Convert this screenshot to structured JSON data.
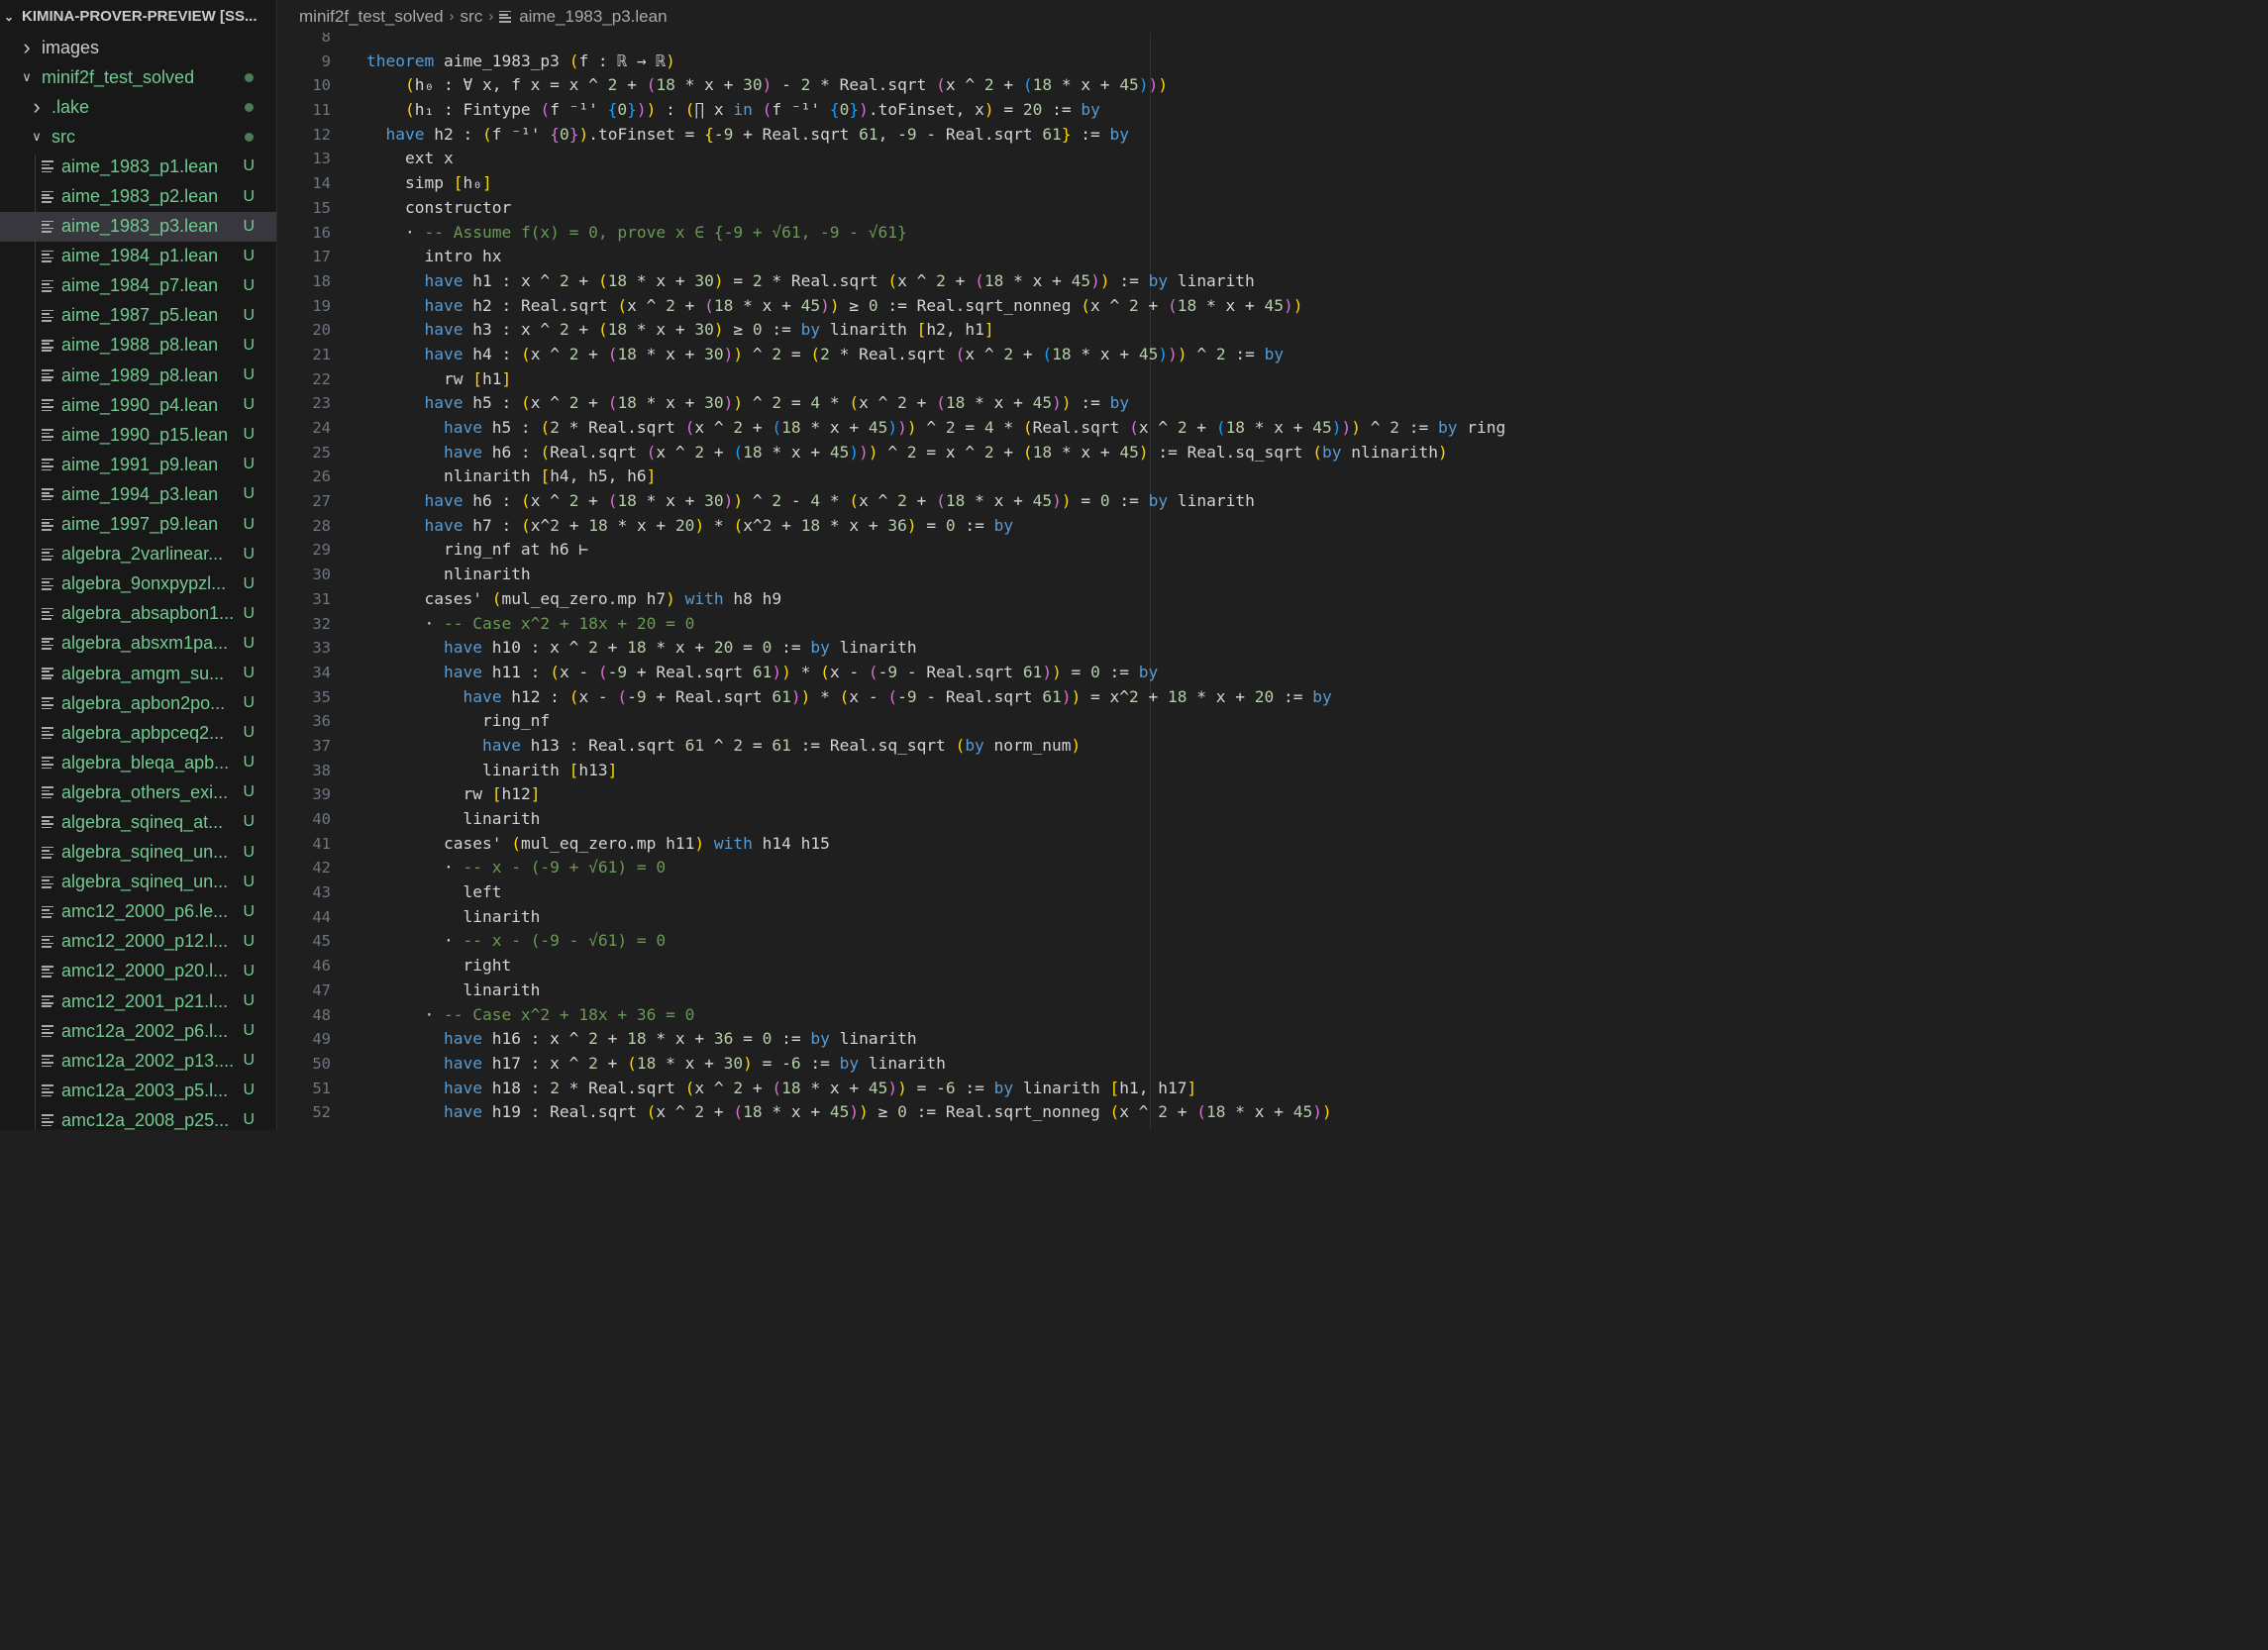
{
  "explorer": {
    "root": "KIMINA-PROVER-PREVIEW [SS...",
    "items": [
      {
        "label": "images",
        "depth": 1,
        "type": "folder",
        "expanded": false,
        "color": "white",
        "status": ""
      },
      {
        "label": "minif2f_test_solved",
        "depth": 1,
        "type": "folder",
        "expanded": true,
        "color": "green",
        "status": "dot"
      },
      {
        "label": ".lake",
        "depth": 2,
        "type": "folder",
        "expanded": false,
        "color": "green",
        "status": "dot"
      },
      {
        "label": "src",
        "depth": 2,
        "type": "folder",
        "expanded": true,
        "color": "green",
        "status": "dot"
      },
      {
        "label": "aime_1983_p1.lean",
        "depth": 3,
        "type": "file",
        "color": "green",
        "status": "U"
      },
      {
        "label": "aime_1983_p2.lean",
        "depth": 3,
        "type": "file",
        "color": "green",
        "status": "U"
      },
      {
        "label": "aime_1983_p3.lean",
        "depth": 3,
        "type": "file",
        "color": "green",
        "status": "U",
        "selected": true
      },
      {
        "label": "aime_1984_p1.lean",
        "depth": 3,
        "type": "file",
        "color": "green",
        "status": "U"
      },
      {
        "label": "aime_1984_p7.lean",
        "depth": 3,
        "type": "file",
        "color": "green",
        "status": "U"
      },
      {
        "label": "aime_1987_p5.lean",
        "depth": 3,
        "type": "file",
        "color": "green",
        "status": "U"
      },
      {
        "label": "aime_1988_p8.lean",
        "depth": 3,
        "type": "file",
        "color": "green",
        "status": "U"
      },
      {
        "label": "aime_1989_p8.lean",
        "depth": 3,
        "type": "file",
        "color": "green",
        "status": "U"
      },
      {
        "label": "aime_1990_p4.lean",
        "depth": 3,
        "type": "file",
        "color": "green",
        "status": "U"
      },
      {
        "label": "aime_1990_p15.lean",
        "depth": 3,
        "type": "file",
        "color": "green",
        "status": "U"
      },
      {
        "label": "aime_1991_p9.lean",
        "depth": 3,
        "type": "file",
        "color": "green",
        "status": "U"
      },
      {
        "label": "aime_1994_p3.lean",
        "depth": 3,
        "type": "file",
        "color": "green",
        "status": "U"
      },
      {
        "label": "aime_1997_p9.lean",
        "depth": 3,
        "type": "file",
        "color": "green",
        "status": "U"
      },
      {
        "label": "algebra_2varlinear...",
        "depth": 3,
        "type": "file",
        "color": "green",
        "status": "U"
      },
      {
        "label": "algebra_9onxpypzl...",
        "depth": 3,
        "type": "file",
        "color": "green",
        "status": "U"
      },
      {
        "label": "algebra_absapbon1...",
        "depth": 3,
        "type": "file",
        "color": "green",
        "status": "U"
      },
      {
        "label": "algebra_absxm1pa...",
        "depth": 3,
        "type": "file",
        "color": "green",
        "status": "U"
      },
      {
        "label": "algebra_amgm_su...",
        "depth": 3,
        "type": "file",
        "color": "green",
        "status": "U"
      },
      {
        "label": "algebra_apbon2po...",
        "depth": 3,
        "type": "file",
        "color": "green",
        "status": "U"
      },
      {
        "label": "algebra_apbpceq2...",
        "depth": 3,
        "type": "file",
        "color": "green",
        "status": "U"
      },
      {
        "label": "algebra_bleqa_apb...",
        "depth": 3,
        "type": "file",
        "color": "green",
        "status": "U"
      },
      {
        "label": "algebra_others_exi...",
        "depth": 3,
        "type": "file",
        "color": "green",
        "status": "U"
      },
      {
        "label": "algebra_sqineq_at...",
        "depth": 3,
        "type": "file",
        "color": "green",
        "status": "U"
      },
      {
        "label": "algebra_sqineq_un...",
        "depth": 3,
        "type": "file",
        "color": "green",
        "status": "U"
      },
      {
        "label": "algebra_sqineq_un...",
        "depth": 3,
        "type": "file",
        "color": "green",
        "status": "U"
      },
      {
        "label": "amc12_2000_p6.le...",
        "depth": 3,
        "type": "file",
        "color": "green",
        "status": "U"
      },
      {
        "label": "amc12_2000_p12.l...",
        "depth": 3,
        "type": "file",
        "color": "green",
        "status": "U"
      },
      {
        "label": "amc12_2000_p20.l...",
        "depth": 3,
        "type": "file",
        "color": "green",
        "status": "U"
      },
      {
        "label": "amc12_2001_p21.l...",
        "depth": 3,
        "type": "file",
        "color": "green",
        "status": "U"
      },
      {
        "label": "amc12a_2002_p6.l...",
        "depth": 3,
        "type": "file",
        "color": "green",
        "status": "U"
      },
      {
        "label": "amc12a_2002_p13....",
        "depth": 3,
        "type": "file",
        "color": "green",
        "status": "U"
      },
      {
        "label": "amc12a_2003_p5.l...",
        "depth": 3,
        "type": "file",
        "color": "green",
        "status": "U"
      },
      {
        "label": "amc12a_2008_p25...",
        "depth": 3,
        "type": "file",
        "color": "green",
        "status": "U"
      }
    ]
  },
  "breadcrumb": [
    "minif2f_test_solved",
    "src",
    "aime_1983_p3.lean"
  ],
  "editor": {
    "first_line": 8,
    "lines": [
      "",
      "theorem aime_1983_p3 (f : ℝ → ℝ)",
      "    (h₀ : ∀ x, f x = x ^ 2 + (18 * x + 30) - 2 * Real.sqrt (x ^ 2 + (18 * x + 45)))",
      "    (h₁ : Fintype (f ⁻¹' {0})) : (∏ x in (f ⁻¹' {0}).toFinset, x) = 20 := by",
      "  have h2 : (f ⁻¹' {0}).toFinset = {-9 + Real.sqrt 61, -9 - Real.sqrt 61} := by",
      "    ext x",
      "    simp [h₀]",
      "    constructor",
      "    · -- Assume f(x) = 0, prove x ∈ {-9 + √61, -9 - √61}",
      "      intro hx",
      "      have h1 : x ^ 2 + (18 * x + 30) = 2 * Real.sqrt (x ^ 2 + (18 * x + 45)) := by linarith",
      "      have h2 : Real.sqrt (x ^ 2 + (18 * x + 45)) ≥ 0 := Real.sqrt_nonneg (x ^ 2 + (18 * x + 45))",
      "      have h3 : x ^ 2 + (18 * x + 30) ≥ 0 := by linarith [h2, h1]",
      "      have h4 : (x ^ 2 + (18 * x + 30)) ^ 2 = (2 * Real.sqrt (x ^ 2 + (18 * x + 45))) ^ 2 := by",
      "        rw [h1]",
      "      have h5 : (x ^ 2 + (18 * x + 30)) ^ 2 = 4 * (x ^ 2 + (18 * x + 45)) := by",
      "        have h5 : (2 * Real.sqrt (x ^ 2 + (18 * x + 45))) ^ 2 = 4 * (Real.sqrt (x ^ 2 + (18 * x + 45))) ^ 2 := by ring",
      "        have h6 : (Real.sqrt (x ^ 2 + (18 * x + 45))) ^ 2 = x ^ 2 + (18 * x + 45) := Real.sq_sqrt (by nlinarith)",
      "        nlinarith [h4, h5, h6]",
      "      have h6 : (x ^ 2 + (18 * x + 30)) ^ 2 - 4 * (x ^ 2 + (18 * x + 45)) = 0 := by linarith",
      "      have h7 : (x^2 + 18 * x + 20) * (x^2 + 18 * x + 36) = 0 := by",
      "        ring_nf at h6 ⊢",
      "        nlinarith",
      "      cases' (mul_eq_zero.mp h7) with h8 h9",
      "      · -- Case x^2 + 18x + 20 = 0",
      "        have h10 : x ^ 2 + 18 * x + 20 = 0 := by linarith",
      "        have h11 : (x - (-9 + Real.sqrt 61)) * (x - (-9 - Real.sqrt 61)) = 0 := by",
      "          have h12 : (x - (-9 + Real.sqrt 61)) * (x - (-9 - Real.sqrt 61)) = x^2 + 18 * x + 20 := by",
      "            ring_nf",
      "            have h13 : Real.sqrt 61 ^ 2 = 61 := Real.sq_sqrt (by norm_num)",
      "            linarith [h13]",
      "          rw [h12]",
      "          linarith",
      "        cases' (mul_eq_zero.mp h11) with h14 h15",
      "        · -- x - (-9 + √61) = 0",
      "          left",
      "          linarith",
      "        · -- x - (-9 - √61) = 0",
      "          right",
      "          linarith",
      "      · -- Case x^2 + 18x + 36 = 0",
      "        have h16 : x ^ 2 + 18 * x + 36 = 0 := by linarith",
      "        have h17 : x ^ 2 + (18 * x + 30) = -6 := by linarith",
      "        have h18 : 2 * Real.sqrt (x ^ 2 + (18 * x + 45)) = -6 := by linarith [h1, h17]",
      "        have h19 : Real.sqrt (x ^ 2 + (18 * x + 45)) ≥ 0 := Real.sqrt_nonneg (x ^ 2 + (18 * x + 45))"
    ]
  },
  "colors": {
    "keyword": "#569cd6",
    "number": "#b5cea8",
    "comment": "#6a9955",
    "bracket_1": "#ffd700",
    "bracket_2": "#da70d6",
    "bracket_3": "#179fff",
    "untracked": "#73c991"
  }
}
